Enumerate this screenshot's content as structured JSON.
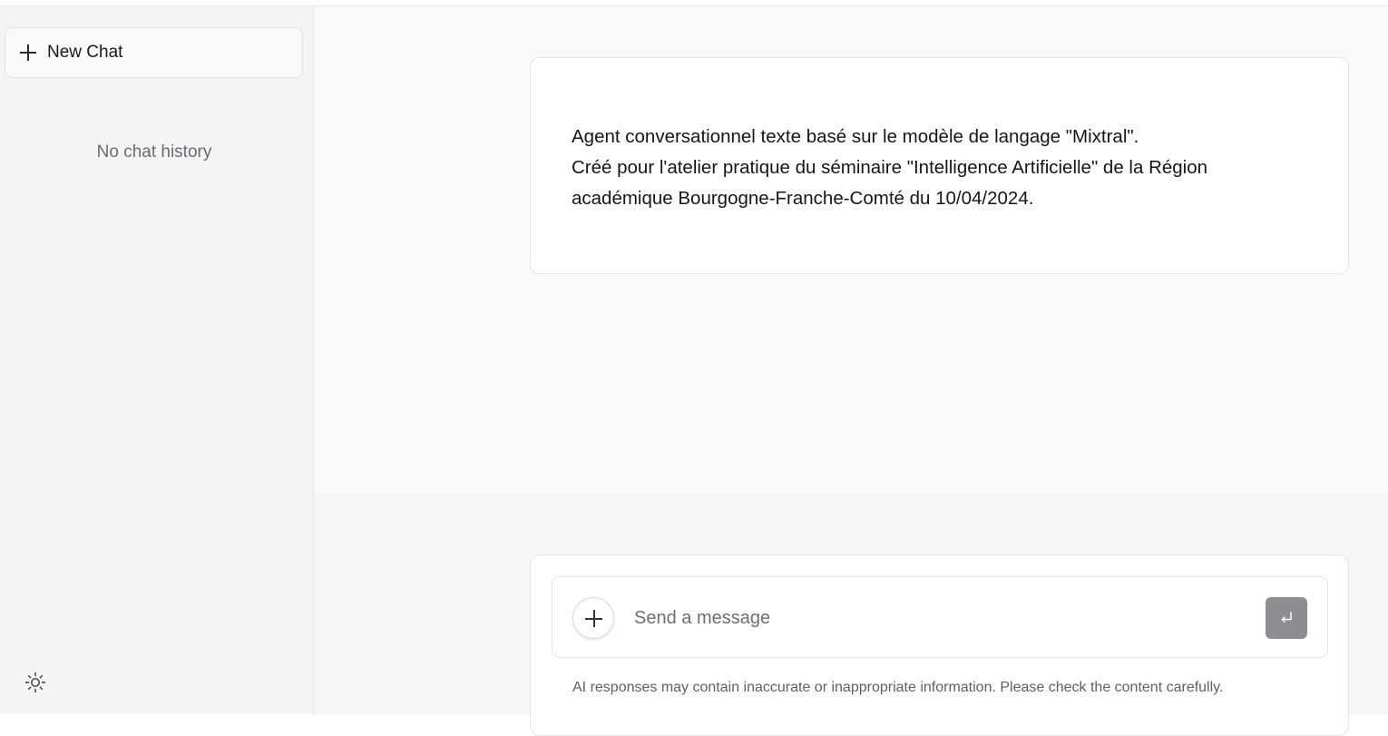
{
  "sidebar": {
    "new_chat_label": "New Chat",
    "empty_history_text": "No chat history",
    "theme_icon": "sun-icon"
  },
  "main": {
    "intro_lines": [
      "Agent conversationnel texte basé sur le modèle de langage \"Mixtral\".",
      "Créé pour l'atelier pratique du séminaire \"Intelligence Artificielle\" de la Région",
      "académique Bourgogne-Franche-Comté du 10/04/2024."
    ]
  },
  "composer": {
    "placeholder": "Send a message",
    "value": "",
    "attach_icon": "plus-icon",
    "send_icon": "enter-icon",
    "disclaimer": "AI responses may contain inaccurate or inappropriate information. Please check the content carefully."
  },
  "colors": {
    "sidebar_bg": "#f4f4f5",
    "main_bg": "#f9f9fa",
    "send_button_bg": "#8e8e92"
  }
}
